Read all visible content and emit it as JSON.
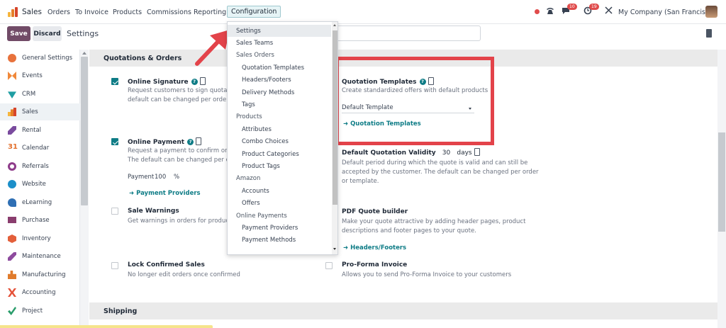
{
  "topnav": {
    "app_name": "Sales",
    "menu": [
      "Orders",
      "To Invoice",
      "Products",
      "Commissions",
      "Reporting",
      "Configuration"
    ],
    "active_menu": "Configuration",
    "chat_badge": "10",
    "activity_badge": "19",
    "company": "My Company (San Francisco)",
    "colors": {
      "brand": "#714b67",
      "accent": "#0e7c86",
      "highlight": "#e3434a"
    }
  },
  "control": {
    "save_label": "Save",
    "discard_label": "Discard",
    "title": "Settings"
  },
  "sidebar": {
    "items": [
      {
        "label": "General Settings",
        "icon": "gear-icon",
        "color": "#e8723c"
      },
      {
        "label": "Events",
        "icon": "events-icon",
        "color": "#f0883a"
      },
      {
        "label": "CRM",
        "icon": "crm-icon",
        "color": "#1f9ea3"
      },
      {
        "label": "Sales",
        "icon": "sales-icon",
        "color": "#e57f28"
      },
      {
        "label": "Rental",
        "icon": "rental-icon",
        "color": "#7a4b9e"
      },
      {
        "label": "Calendar",
        "icon": "calendar-icon",
        "color": "#e3702d"
      },
      {
        "label": "Referrals",
        "icon": "referrals-icon",
        "color": "#8e3c8a"
      },
      {
        "label": "Website",
        "icon": "website-icon",
        "color": "#1c8fc9"
      },
      {
        "label": "eLearning",
        "icon": "elearning-icon",
        "color": "#2f6fb4"
      },
      {
        "label": "Purchase",
        "icon": "purchase-icon",
        "color": "#8a3d6e"
      },
      {
        "label": "Inventory",
        "icon": "inventory-icon",
        "color": "#e35f3a"
      },
      {
        "label": "Maintenance",
        "icon": "maintenance-icon",
        "color": "#8e4b9e"
      },
      {
        "label": "Manufacturing",
        "icon": "manufacturing-icon",
        "color": "#e07b2c"
      },
      {
        "label": "Accounting",
        "icon": "accounting-icon",
        "color": "#e5533a"
      },
      {
        "label": "Project",
        "icon": "project-icon",
        "color": "#2a9d6b"
      }
    ],
    "active_index": 3
  },
  "sections": {
    "quotations": "Quotations & Orders",
    "shipping": "Shipping"
  },
  "settings": {
    "online_signature": {
      "title": "Online Signature",
      "desc1": "Request customers to sign quotatio",
      "desc2": "default can be changed per order o"
    },
    "online_payment": {
      "title": "Online Payment",
      "desc1": "Request a payment to confirm orde",
      "desc2": "The default can be changed per ord",
      "payment_label": "Payment",
      "payment_value": "100",
      "payment_unit": "%",
      "link": "➜ Payment Providers"
    },
    "sale_warnings": {
      "title": "Sale Warnings",
      "desc": "Get warnings in orders for products"
    },
    "lock_confirmed": {
      "title": "Lock Confirmed Sales",
      "desc": "No longer edit orders once confirmed"
    },
    "quotation_templates": {
      "title": "Quotation Templates",
      "desc": "Create standardized offers with default products",
      "select_value": "Default Template",
      "link": "➜ Quotation Templates"
    },
    "validity": {
      "title": "Default Quotation Validity",
      "days_value": "30",
      "days_unit": "days",
      "desc1": "Default period during which the quote is valid and can still be",
      "desc2": "accepted by the customer. The default can be changed per order",
      "desc3": "or template."
    },
    "pdf_builder": {
      "title": "PDF Quote builder",
      "desc1": "Make your quote attractive by adding header pages, product",
      "desc2": "descriptions and footer pages to your quote.",
      "link": "➜ Headers/Footers"
    },
    "proforma": {
      "title": "Pro-Forma Invoice",
      "desc": "Allows you to send Pro-Forma Invoice to your customers"
    }
  },
  "dropdown": {
    "items": [
      {
        "label": "Settings",
        "type": "item",
        "indent": false,
        "active": true
      },
      {
        "label": "Sales Teams",
        "type": "item",
        "indent": false
      },
      {
        "label": "Sales Orders",
        "type": "head"
      },
      {
        "label": "Quotation Templates",
        "type": "item",
        "indent": true
      },
      {
        "label": "Headers/Footers",
        "type": "item",
        "indent": true
      },
      {
        "label": "Delivery Methods",
        "type": "item",
        "indent": true
      },
      {
        "label": "Tags",
        "type": "item",
        "indent": true
      },
      {
        "label": "Products",
        "type": "head"
      },
      {
        "label": "Attributes",
        "type": "item",
        "indent": true
      },
      {
        "label": "Combo Choices",
        "type": "item",
        "indent": true
      },
      {
        "label": "Product Categories",
        "type": "item",
        "indent": true
      },
      {
        "label": "Product Tags",
        "type": "item",
        "indent": true
      },
      {
        "label": "Amazon",
        "type": "head"
      },
      {
        "label": "Accounts",
        "type": "item",
        "indent": true
      },
      {
        "label": "Offers",
        "type": "item",
        "indent": true
      },
      {
        "label": "Online Payments",
        "type": "head"
      },
      {
        "label": "Payment Providers",
        "type": "item",
        "indent": true
      },
      {
        "label": "Payment Methods",
        "type": "item",
        "indent": true
      }
    ]
  }
}
